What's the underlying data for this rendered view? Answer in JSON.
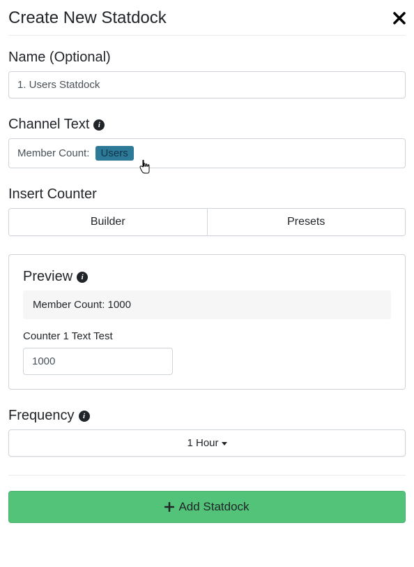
{
  "header": {
    "title": "Create New Statdock"
  },
  "name": {
    "label": "Name (Optional)",
    "value": "1. Users Statdock"
  },
  "channel_text": {
    "label": "Channel Text",
    "prefix": "Member Count:",
    "tag": "Users"
  },
  "insert_counter": {
    "label": "Insert Counter",
    "tabs": [
      "Builder",
      "Presets"
    ]
  },
  "preview": {
    "label": "Preview",
    "resolved_text": "Member Count: 1000",
    "counter_test_label": "Counter 1 Text Test",
    "counter_test_value": "1000"
  },
  "frequency": {
    "label": "Frequency",
    "selected": "1 Hour"
  },
  "footer": {
    "add_label": "Add Statdock"
  },
  "icons": {
    "info_glyph": "i"
  }
}
